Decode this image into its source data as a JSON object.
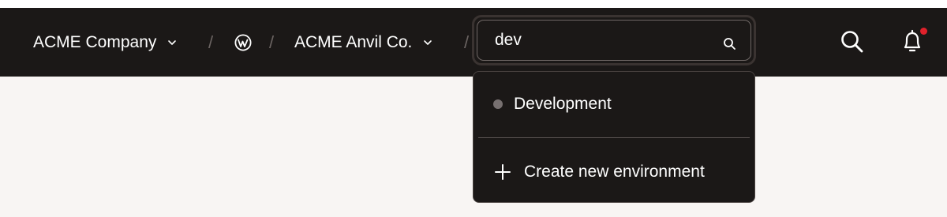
{
  "breadcrumb": {
    "company": "ACME Company",
    "separator": "/",
    "site": "ACME Anvil Co."
  },
  "search": {
    "value": "dev",
    "placeholder": ""
  },
  "dropdown": {
    "items": [
      {
        "label": "Development",
        "status_color": "#777070"
      }
    ],
    "create_label": "Create new environment"
  },
  "icons": {
    "company_chevron": "chevron-down-icon",
    "site_logo": "wordpress-icon",
    "search": "search-icon",
    "notifications": "bell-icon"
  },
  "colors": {
    "topbar": "#1b1817",
    "background": "#f8f5f3",
    "notification_dot": "#e0212b"
  }
}
